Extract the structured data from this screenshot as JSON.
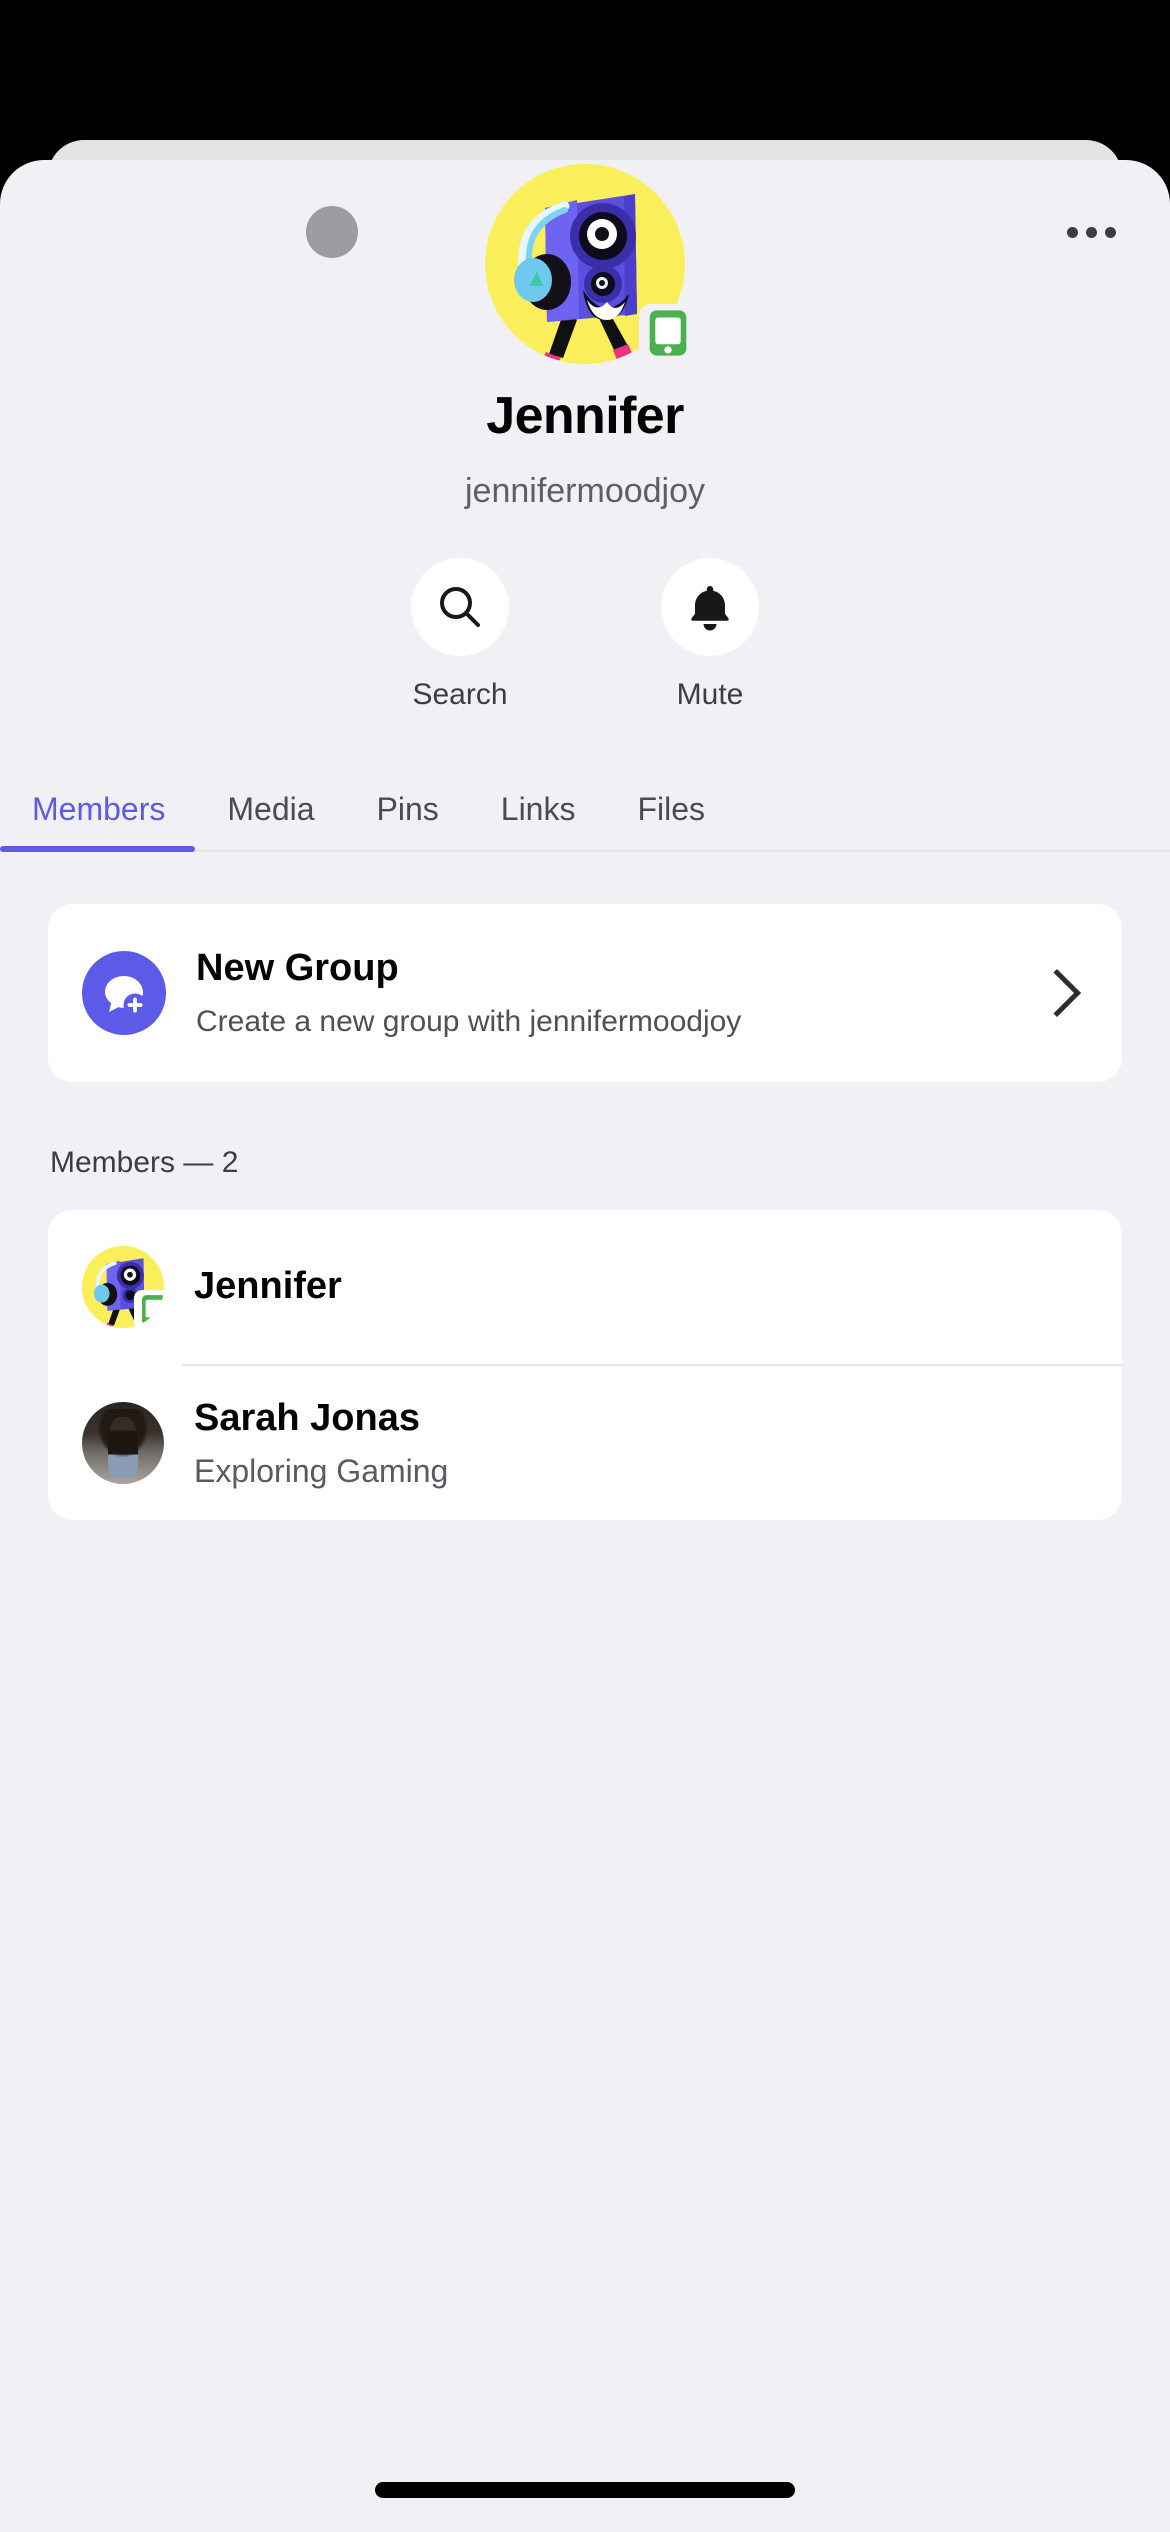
{
  "header": {
    "more_icon": "more-horizontal-icon",
    "placeholder_avatar": "avatar-placeholder"
  },
  "profile": {
    "avatar_icon": "speaker-character-avatar",
    "avatar_background_color": "#FAEF5B",
    "presence_badge_icon": "mobile-phone-icon",
    "presence_badge_color": "#4CAF50",
    "display_name": "Jennifer",
    "username": "jennifermoodjoy"
  },
  "actions": [
    {
      "label": "Search",
      "icon": "search-icon"
    },
    {
      "label": "Mute",
      "icon": "bell-icon"
    }
  ],
  "tabs": {
    "active_index": 0,
    "active_color": "#5B5BE8",
    "items": [
      {
        "label": "Members"
      },
      {
        "label": "Media"
      },
      {
        "label": "Pins"
      },
      {
        "label": "Links"
      },
      {
        "label": "Files"
      }
    ]
  },
  "new_group": {
    "icon": "chat-bubble-plus-icon",
    "icon_color": "#5B5BE8",
    "title": "New Group",
    "subtitle": "Create a new group with jennifermoodjoy",
    "chevron_icon": "chevron-right-icon"
  },
  "members_section": {
    "label": "Members — 2",
    "items": [
      {
        "name": "Jennifer",
        "status": "",
        "avatar_icon": "speaker-character-avatar",
        "presence_badge_icon": "mobile-phone-icon"
      },
      {
        "name": "Sarah Jonas",
        "status": "Exploring Gaming",
        "avatar_icon": "user-photo-avatar",
        "presence_badge_icon": ""
      }
    ]
  },
  "system": {
    "home_indicator": "home-indicator"
  }
}
